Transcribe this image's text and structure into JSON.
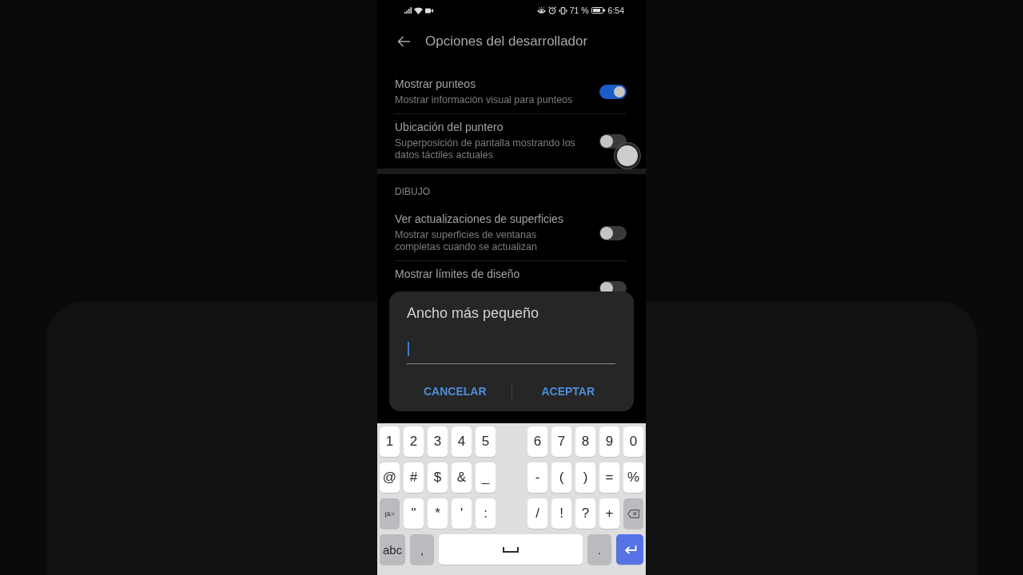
{
  "status_bar": {
    "battery": "71 %",
    "time": "6:54"
  },
  "app_bar": {
    "title": "Opciones del desarrollador"
  },
  "settings": [
    {
      "kind": "toggle",
      "title": "Mostrar punteos",
      "summary": "Mostrar información visual para punteos",
      "on": true
    },
    {
      "kind": "toggle",
      "title": "Ubicación del puntero",
      "summary": "Superposición de pantalla mostrando los datos táctiles actuales",
      "on": false
    },
    {
      "kind": "section",
      "title": "DIBUJO"
    },
    {
      "kind": "toggle",
      "title": "Ver actualizaciones de superficies",
      "summary": "Mostrar superficies de ventanas completas cuando se actualizan",
      "on": false
    },
    {
      "kind": "toggle",
      "title": "Mostrar límites de diseño",
      "on": false
    }
  ],
  "dialog": {
    "title": "Ancho más pequeño",
    "field": {
      "focused": true
    },
    "buttons": [
      "CANCELAR",
      "ACEPTAR"
    ]
  },
  "keyboard": {
    "rows": [
      {
        "groups": [
          [
            {
              "kind": "char",
              "label": "1"
            },
            {
              "kind": "char",
              "label": "2"
            },
            {
              "kind": "char",
              "label": "3"
            },
            {
              "kind": "char",
              "label": "4"
            },
            {
              "kind": "char",
              "label": "5"
            }
          ],
          [
            {
              "kind": "char",
              "label": "6"
            },
            {
              "kind": "char",
              "label": "7"
            },
            {
              "kind": "char",
              "label": "8"
            },
            {
              "kind": "char",
              "label": "9"
            },
            {
              "kind": "char",
              "label": "0"
            }
          ]
        ]
      },
      {
        "groups": [
          [
            {
              "kind": "char",
              "label": "@"
            },
            {
              "kind": "char",
              "label": "#"
            },
            {
              "kind": "char",
              "label": "$"
            },
            {
              "kind": "char",
              "label": "&"
            },
            {
              "kind": "char",
              "label": "_"
            }
          ],
          [
            {
              "kind": "char",
              "label": "-"
            },
            {
              "kind": "char",
              "label": "("
            },
            {
              "kind": "char",
              "label": ")"
            },
            {
              "kind": "char",
              "label": "="
            },
            {
              "kind": "char",
              "label": "%"
            }
          ]
        ]
      },
      {
        "groups": [
          [
            {
              "kind": "function",
              "label": "{&="
            },
            {
              "kind": "char",
              "label": "\""
            },
            {
              "kind": "char",
              "label": "*"
            },
            {
              "kind": "char",
              "label": "'"
            },
            {
              "kind": "char",
              "label": ":"
            }
          ],
          [
            {
              "kind": "char",
              "label": "/"
            },
            {
              "kind": "char",
              "label": "!"
            },
            {
              "kind": "char",
              "label": "?"
            },
            {
              "kind": "char",
              "label": "+"
            },
            {
              "kind": "backspace"
            }
          ]
        ]
      },
      {
        "groups": [
          [
            {
              "kind": "function",
              "label": "abc"
            },
            {
              "kind": "function",
              "label": ","
            },
            {
              "kind": "space"
            },
            {
              "kind": "function",
              "label": "."
            },
            {
              "kind": "enter"
            }
          ]
        ]
      }
    ]
  }
}
